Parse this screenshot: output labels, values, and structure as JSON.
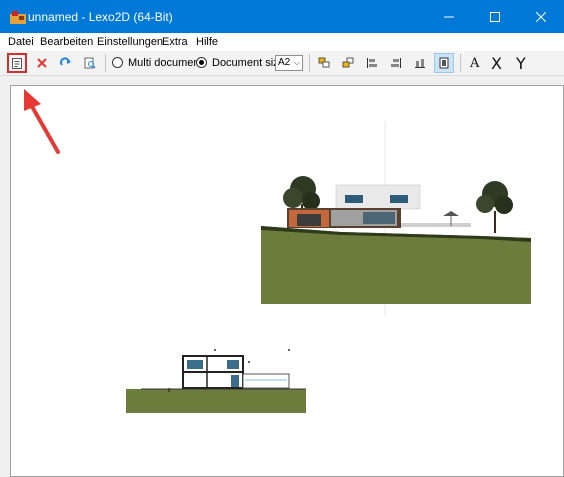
{
  "window": {
    "title": "unnamed - Lexo2D (64-Bit)"
  },
  "menu": {
    "items": [
      "Datei",
      "Bearbeiten",
      "Einstellungen",
      "Extra",
      "Hilfe"
    ]
  },
  "toolbar": {
    "multi_document_label": "Multi document",
    "document_size_label": "Document size",
    "document_size_value": "A2",
    "letter_a": "A",
    "letter_x": "X",
    "letter_y": "Y",
    "selected_mode": "document_size",
    "icons": [
      "new-document-icon",
      "delete-icon",
      "redo-icon",
      "print-preview-icon",
      "align-top-left-icon",
      "align-bottom-left-icon",
      "align-left-icon",
      "align-right-icon",
      "align-bottom-icon",
      "bring-to-front-icon"
    ]
  },
  "colors": {
    "titlebar": "#0078d7",
    "annotation_arrow": "#e53935",
    "highlight_box": "#d32f2f",
    "terrain": "#6b7c3d"
  }
}
